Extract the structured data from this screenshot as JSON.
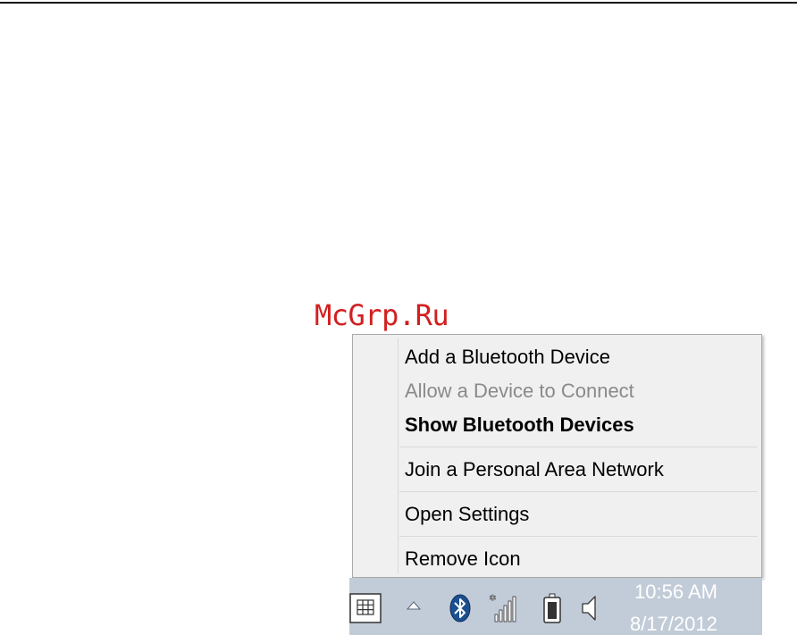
{
  "watermark": "McGrp.Ru",
  "menu": {
    "items": [
      {
        "label": "Add a Bluetooth Device"
      },
      {
        "label": "Allow a Device to Connect"
      },
      {
        "label": "Show Bluetooth Devices"
      },
      {
        "label": "Join a Personal Area Network"
      },
      {
        "label": "Open Settings"
      },
      {
        "label": "Remove Icon"
      }
    ]
  },
  "taskbar": {
    "icons": [
      "keyboard-icon",
      "chevron-up-icon",
      "bluetooth-icon",
      "network-signal-icon",
      "battery-icon",
      "speaker-icon"
    ],
    "clock": {
      "time": "10:56 AM",
      "date": "8/17/2012"
    }
  },
  "colors": {
    "watermark": "#d21f1f",
    "menu_background": "#f0f0f0",
    "disabled_text": "#8a8a8a",
    "taskbar_background": "#c2ccd8",
    "bluetooth_badge": "#1c4f8f"
  }
}
